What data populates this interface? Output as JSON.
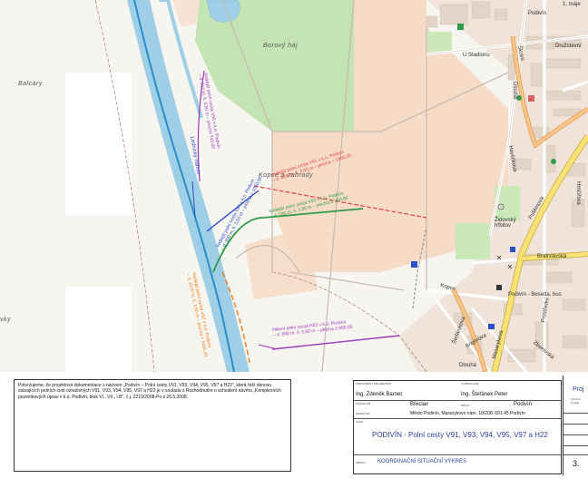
{
  "map": {
    "places": {
      "balcary": "Balcary",
      "borovy_haj": "Borový háj",
      "kopce_zahrady": "Kopce a zahrady",
      "vky": "vky"
    },
    "streets": {
      "u_stadionu": "U Stadionu",
      "druzstevni": "Družstevní",
      "bratislavska": "Bratislavská",
      "kopce": "Kopce",
      "podivin_beseda_bus": "Podivín - Beseda, bus",
      "zidovsky_hrbitov": "Židovský hřbitov",
      "skolni": "Školní",
      "puskinova": "Puškinova",
      "masarykova": "Masarykova",
      "anglerova": "Angerova",
      "havlickova": "Havlíčkova",
      "stalinova": "Štefánikova",
      "zborovska": "Zborovská",
      "prostredni": "Prostřední",
      "podivin_okraj": "Podivín",
      "dlouha": "Dlouhá",
      "nam_1_maje": "1. máje",
      "hrnir": "Hrnčířská",
      "strm": "Dlouhá"
    },
    "annotations": {
      "red": "Vedlejší polní cesta V91 v k.ú. Podivín\n– d. 568 m, š. 3,50 m – plocha = 1985,00",
      "green": "Vedlejší polní cesta V93 v k.ú. Podivín\n– d. 780 m, š. 3,50 m – plocha 6 200,00",
      "blue": "Vedlejší polní cesta V94 v k.ú. Podivín\n– d. 300 m, š. 3,50 m – plocha = 1050,00",
      "purple_top": "Vedlejší polní cesta V95 v k.ú. Podivín\n– d. 212 m, š. 3,50 m – plocha 743,00",
      "lednice": "Lednický náhon",
      "orange": "Vedlejší polní cesta V97 v k.ú. Podivín\n– d. 1570 m, š. 3,50 m – plocha = 5495,00",
      "purple_bottom": "Hlavní polní cesta H22 v k.ú. Podivín\n– d. 690 m, š. 5,50 m – plocha 2 885,00"
    },
    "colors": {
      "water": "#9ecfe6",
      "forest": "#c8e6b8",
      "field": "#f5ddca",
      "urban": "#f1e7dd",
      "road_major": "#f7e275",
      "road_orange": "#f5b165",
      "red": "#e8434a",
      "green": "#2e9b48",
      "blue": "#2a4fc9",
      "purple": "#9a37b8",
      "orange": "#f07b1b"
    }
  },
  "notice": {
    "text": "Potvrzujeme, že projektová dokumentace s názvem „Podivín – Polní cesty V91, V93, V94, V95, V97 a H22“, která řeší obnovu stávajících polních cest označených V91, V93, V94, V95, V97 a H22 je v souladu s Rozhodnutím o schválení návrhu „Komplexních pozemkových úprav v k.ú. Podivín, blok VI., VII., I.B“, č.j. 2219/2008-Po z 26.5.2008."
  },
  "title_block": {
    "labels": {
      "responsible": "ODPOVĚDNÝ PROJEKTANT",
      "drew": "VYPRACOVAL",
      "office": "KANCELÁŘ",
      "investor": "INVESTOR",
      "place": "MÍSTO",
      "stage": "AKCE",
      "content": "OBSAH"
    },
    "responsible_name": "Ing. Zdeněk Barnet",
    "drew_name": "Ing. Štefánek Peter",
    "office_value": "Břeclav",
    "place_value": "Podivín",
    "investor_value": "Město Podivín, Masarykovo nám. 18/208, 691 45 Podivín",
    "project_title": "PODIVÍN - Polní cesty V91, V93, V94, V95, V97 a H22",
    "drawing_title": "KOORDINAČNÍ SITUAČNÍ VÝKRES",
    "right_label": "Proj",
    "right_small": "Výrobní\nprojekt",
    "sheet_number": "3."
  }
}
